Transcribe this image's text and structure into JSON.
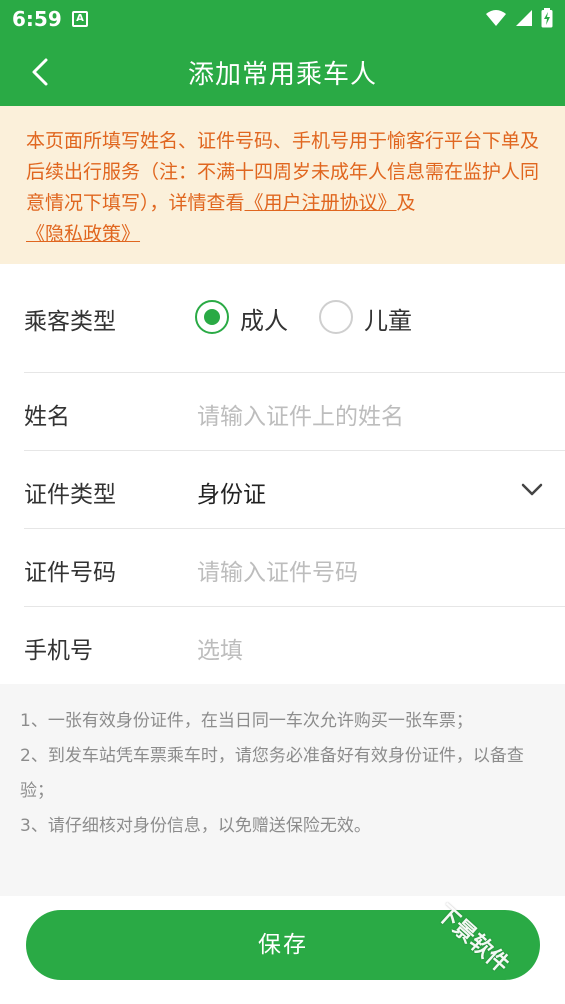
{
  "status_bar": {
    "time": "6:59",
    "notification_letter": "A"
  },
  "header": {
    "title": "添加常用乘车人"
  },
  "notice": {
    "text_part1": "本页面所填写姓名、证件号码、手机号用于愉客行平台下单及后续出行服务（注：不满十四周岁未成年人信息需在监护人同意情况下填写），详情查看",
    "link_user_agreement": "《用户注册协议》",
    "text_and": "及",
    "link_privacy": "《隐私政策》"
  },
  "form": {
    "passenger_type": {
      "label": "乘客类型",
      "options": [
        "成人",
        "儿童"
      ],
      "selected": "成人"
    },
    "name": {
      "label": "姓名",
      "placeholder": "请输入证件上的姓名"
    },
    "id_type": {
      "label": "证件类型",
      "value": "身份证"
    },
    "id_number": {
      "label": "证件号码",
      "placeholder": "请输入证件号码"
    },
    "phone": {
      "label": "手机号",
      "placeholder": "选填"
    }
  },
  "tips": [
    "1、一张有效身份证件，在当日同一车次允许购买一张车票；",
    "2、到发车站凭车票乘车时，请您务必准备好有效身份证件，以备查验；",
    "3、请仔细核对身份信息，以免赠送保险无效。"
  ],
  "footer": {
    "save_label": "保存"
  },
  "watermark": {
    "text": "下景软件"
  },
  "colors": {
    "primary": "#2aaa45",
    "notice_bg": "#fbf0da",
    "notice_text": "#e0661f",
    "placeholder": "#bdbdbd"
  }
}
